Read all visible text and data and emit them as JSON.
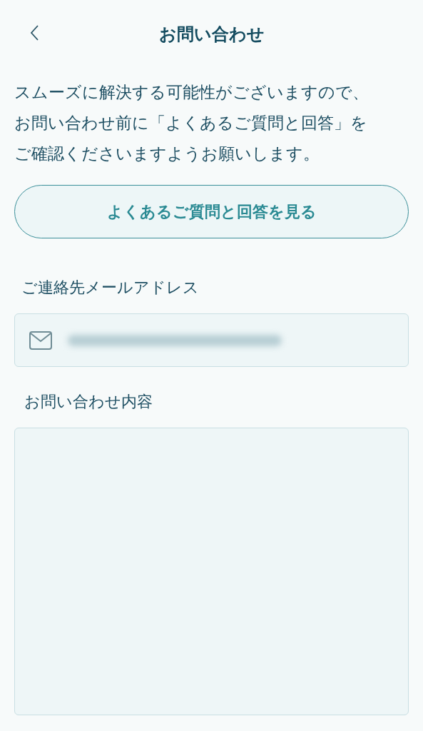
{
  "header": {
    "title": "お問い合わせ"
  },
  "notice": {
    "lines": [
      "スムーズに解決する可能性がございますので、",
      "お問い合わせ前に「よくあるご質問と回答」を",
      "ご確認くださいますようお願いします。"
    ]
  },
  "faq_button": {
    "label": "よくあるご質問と回答を見る"
  },
  "email": {
    "label": "ご連絡先メールアドレス",
    "value_blurred": true
  },
  "message": {
    "label": "お問い合わせ内容"
  }
}
